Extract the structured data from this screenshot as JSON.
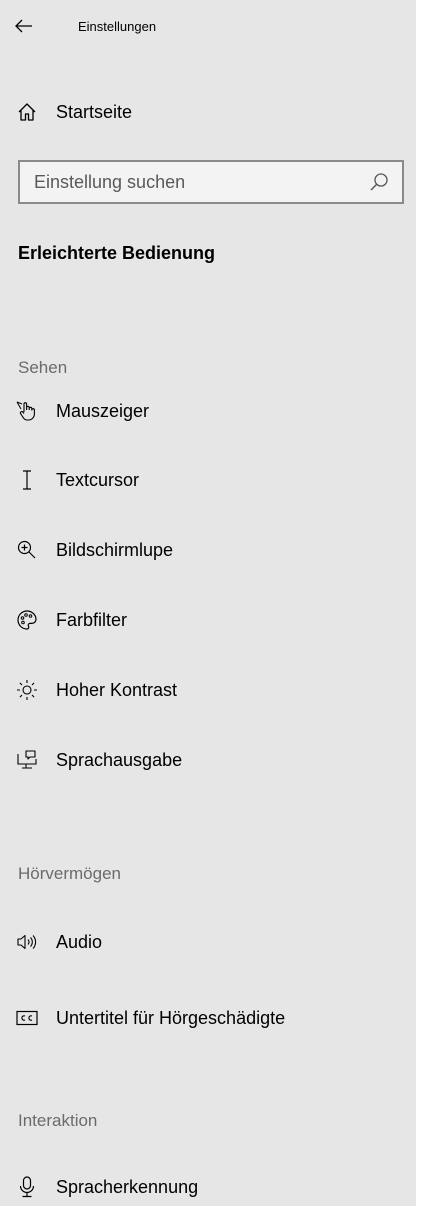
{
  "header": {
    "back_icon": "arrow-left-icon",
    "title": "Einstellungen"
  },
  "home": {
    "icon": "home-icon",
    "label": "Startseite"
  },
  "search": {
    "placeholder": "Einstellung suchen",
    "value": "",
    "icon": "search-icon"
  },
  "section": {
    "title": "Erleichterte Bedienung"
  },
  "groups": {
    "sehen": {
      "header": "Sehen",
      "items": [
        {
          "label": "Mauszeiger",
          "icon": "mouse-pointer-icon"
        },
        {
          "label": "Textcursor",
          "icon": "text-cursor-icon"
        },
        {
          "label": "Bildschirmlupe",
          "icon": "magnifier-icon"
        },
        {
          "label": "Farbfilter",
          "icon": "palette-icon"
        },
        {
          "label": "Hoher Kontrast",
          "icon": "sun-contrast-icon"
        },
        {
          "label": "Sprachausgabe",
          "icon": "narrator-icon"
        }
      ]
    },
    "hoeren": {
      "header": "Hörvermögen",
      "items": [
        {
          "label": "Audio",
          "icon": "speaker-icon"
        },
        {
          "label": "Untertitel für Hörgeschädigte",
          "icon": "closed-captions-icon"
        }
      ]
    },
    "interaktion": {
      "header": "Interaktion",
      "items": [
        {
          "label": "Spracherkennung",
          "icon": "microphone-icon"
        }
      ]
    }
  },
  "colors": {
    "panel_background": "#e6e6e6",
    "group_header_text": "#6b6b6b",
    "search_border": "#8a8a8a"
  }
}
